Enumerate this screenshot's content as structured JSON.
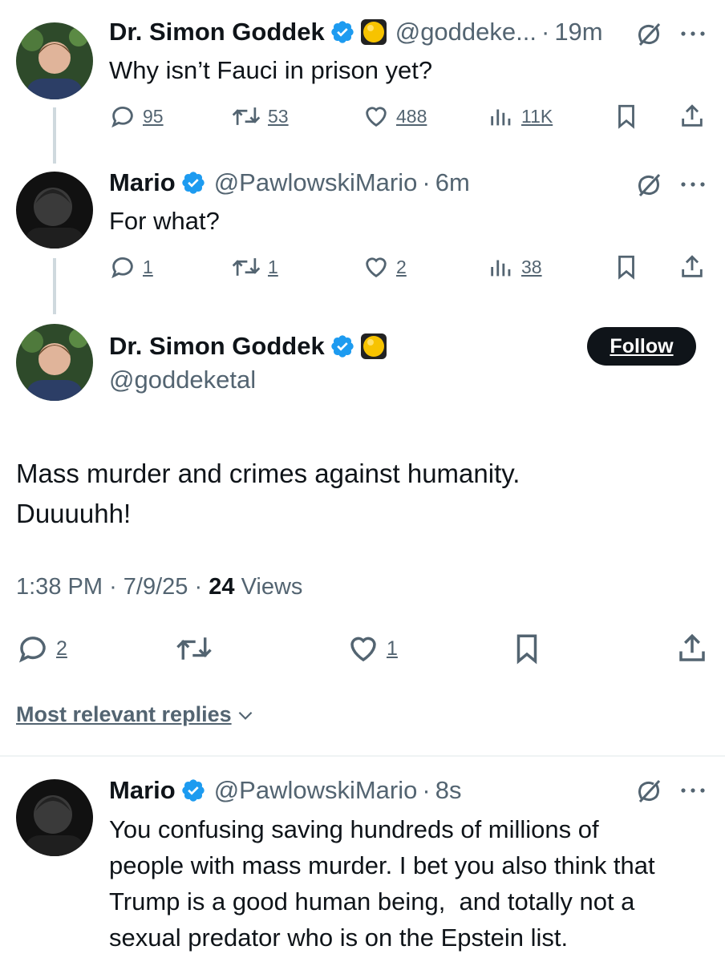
{
  "tweet1": {
    "name": "Dr. Simon Goddek",
    "handle": "@goddeke...",
    "time": "19m",
    "text": "Why isn’t Fauci in prison yet?",
    "replies": "95",
    "retweets": "53",
    "likes": "488",
    "views": "11K"
  },
  "tweet2": {
    "name": "Mario",
    "handle": "@PawlowskiMario",
    "time": "6m",
    "text": "For what?",
    "replies": "1",
    "retweets": "1",
    "likes": "2",
    "views": "38"
  },
  "main": {
    "name": "Dr. Simon Goddek",
    "handle": "@goddeketal",
    "follow_label": "Follow",
    "text_line1": "Mass murder and crimes against humanity.",
    "text_line2": "Duuuuhh!",
    "time": "1:38 PM",
    "date": "7/9/25",
    "views_count": "24",
    "views_label": "Views",
    "replies": "2",
    "likes": "1"
  },
  "replies_sort": {
    "label": "Most relevant replies"
  },
  "reply": {
    "name": "Mario",
    "handle": "@PawlowskiMario",
    "time": "8s",
    "line1": "You confusing saving hundreds of millions of",
    "line2": "people with mass murder. I bet you also think that",
    "line3": "Trump is a good human being,  and totally not a",
    "line4": "sexual predator who is on the Epstein list."
  },
  "colors": {
    "verified": "#1d9bf0",
    "text": "#0f1419",
    "muted": "#536471",
    "emoji_yellow": "#f7c300"
  },
  "icons": [
    "verified-badge-icon",
    "yellow-circle-emoji-icon",
    "grok-icon",
    "more-icon",
    "reply-icon",
    "retweet-icon",
    "like-icon",
    "views-icon",
    "bookmark-icon",
    "share-icon",
    "chevron-down-icon"
  ]
}
